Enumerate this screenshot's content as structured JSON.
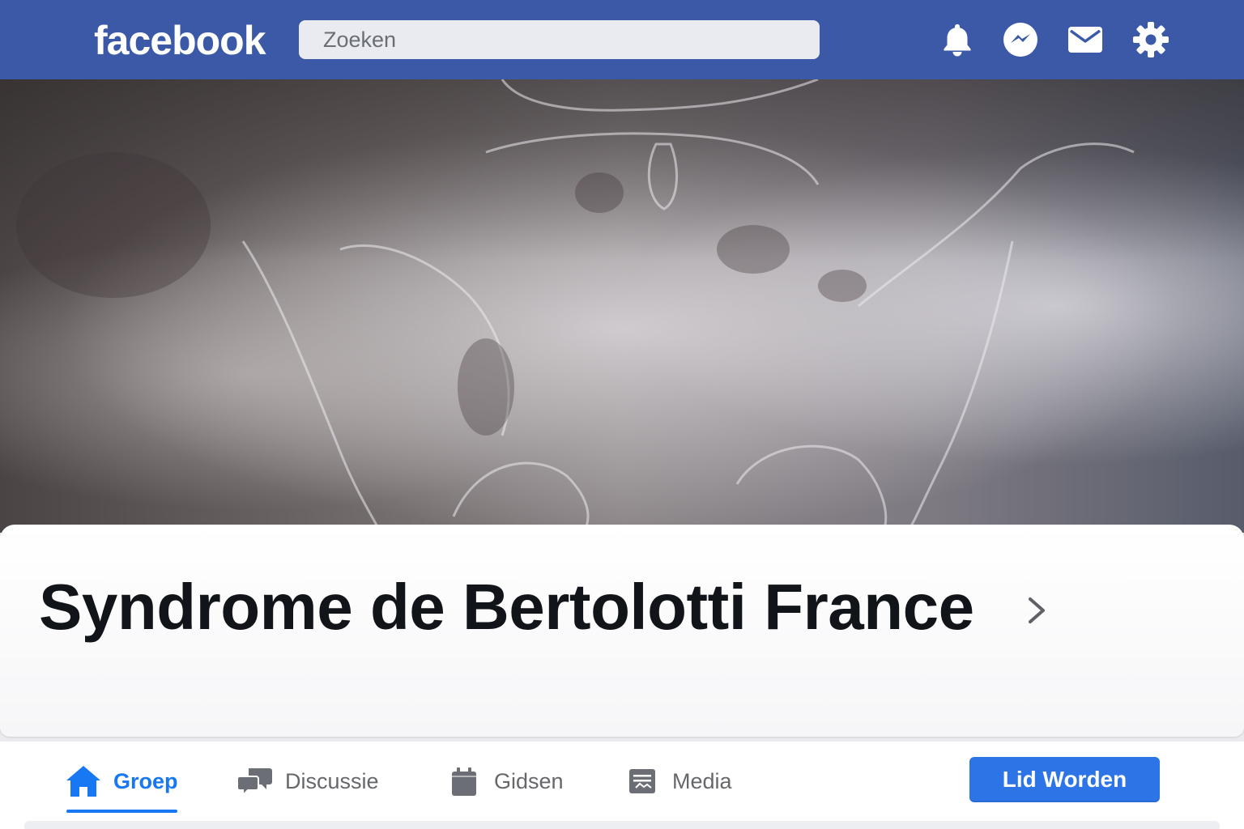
{
  "header": {
    "logo": "facebook",
    "search_placeholder": "Zoeken",
    "icons": [
      "bell-icon",
      "messenger-icon",
      "mail-icon",
      "gear-icon"
    ],
    "bar_color": "#3b59a6"
  },
  "group": {
    "title": "Syndrome de Bertolotti France"
  },
  "nav": {
    "tabs": [
      {
        "label": "Groep",
        "icon": "home-icon",
        "active": true
      },
      {
        "label": "Discussie",
        "icon": "chat-bubbles-icon"
      },
      {
        "label": "Gidsen",
        "icon": "guide-icon"
      },
      {
        "label": "Media",
        "icon": "media-icon"
      }
    ],
    "join_label": "Lid Worden"
  },
  "colors": {
    "accent": "#1877f2",
    "join_button": "#2d74e6"
  }
}
